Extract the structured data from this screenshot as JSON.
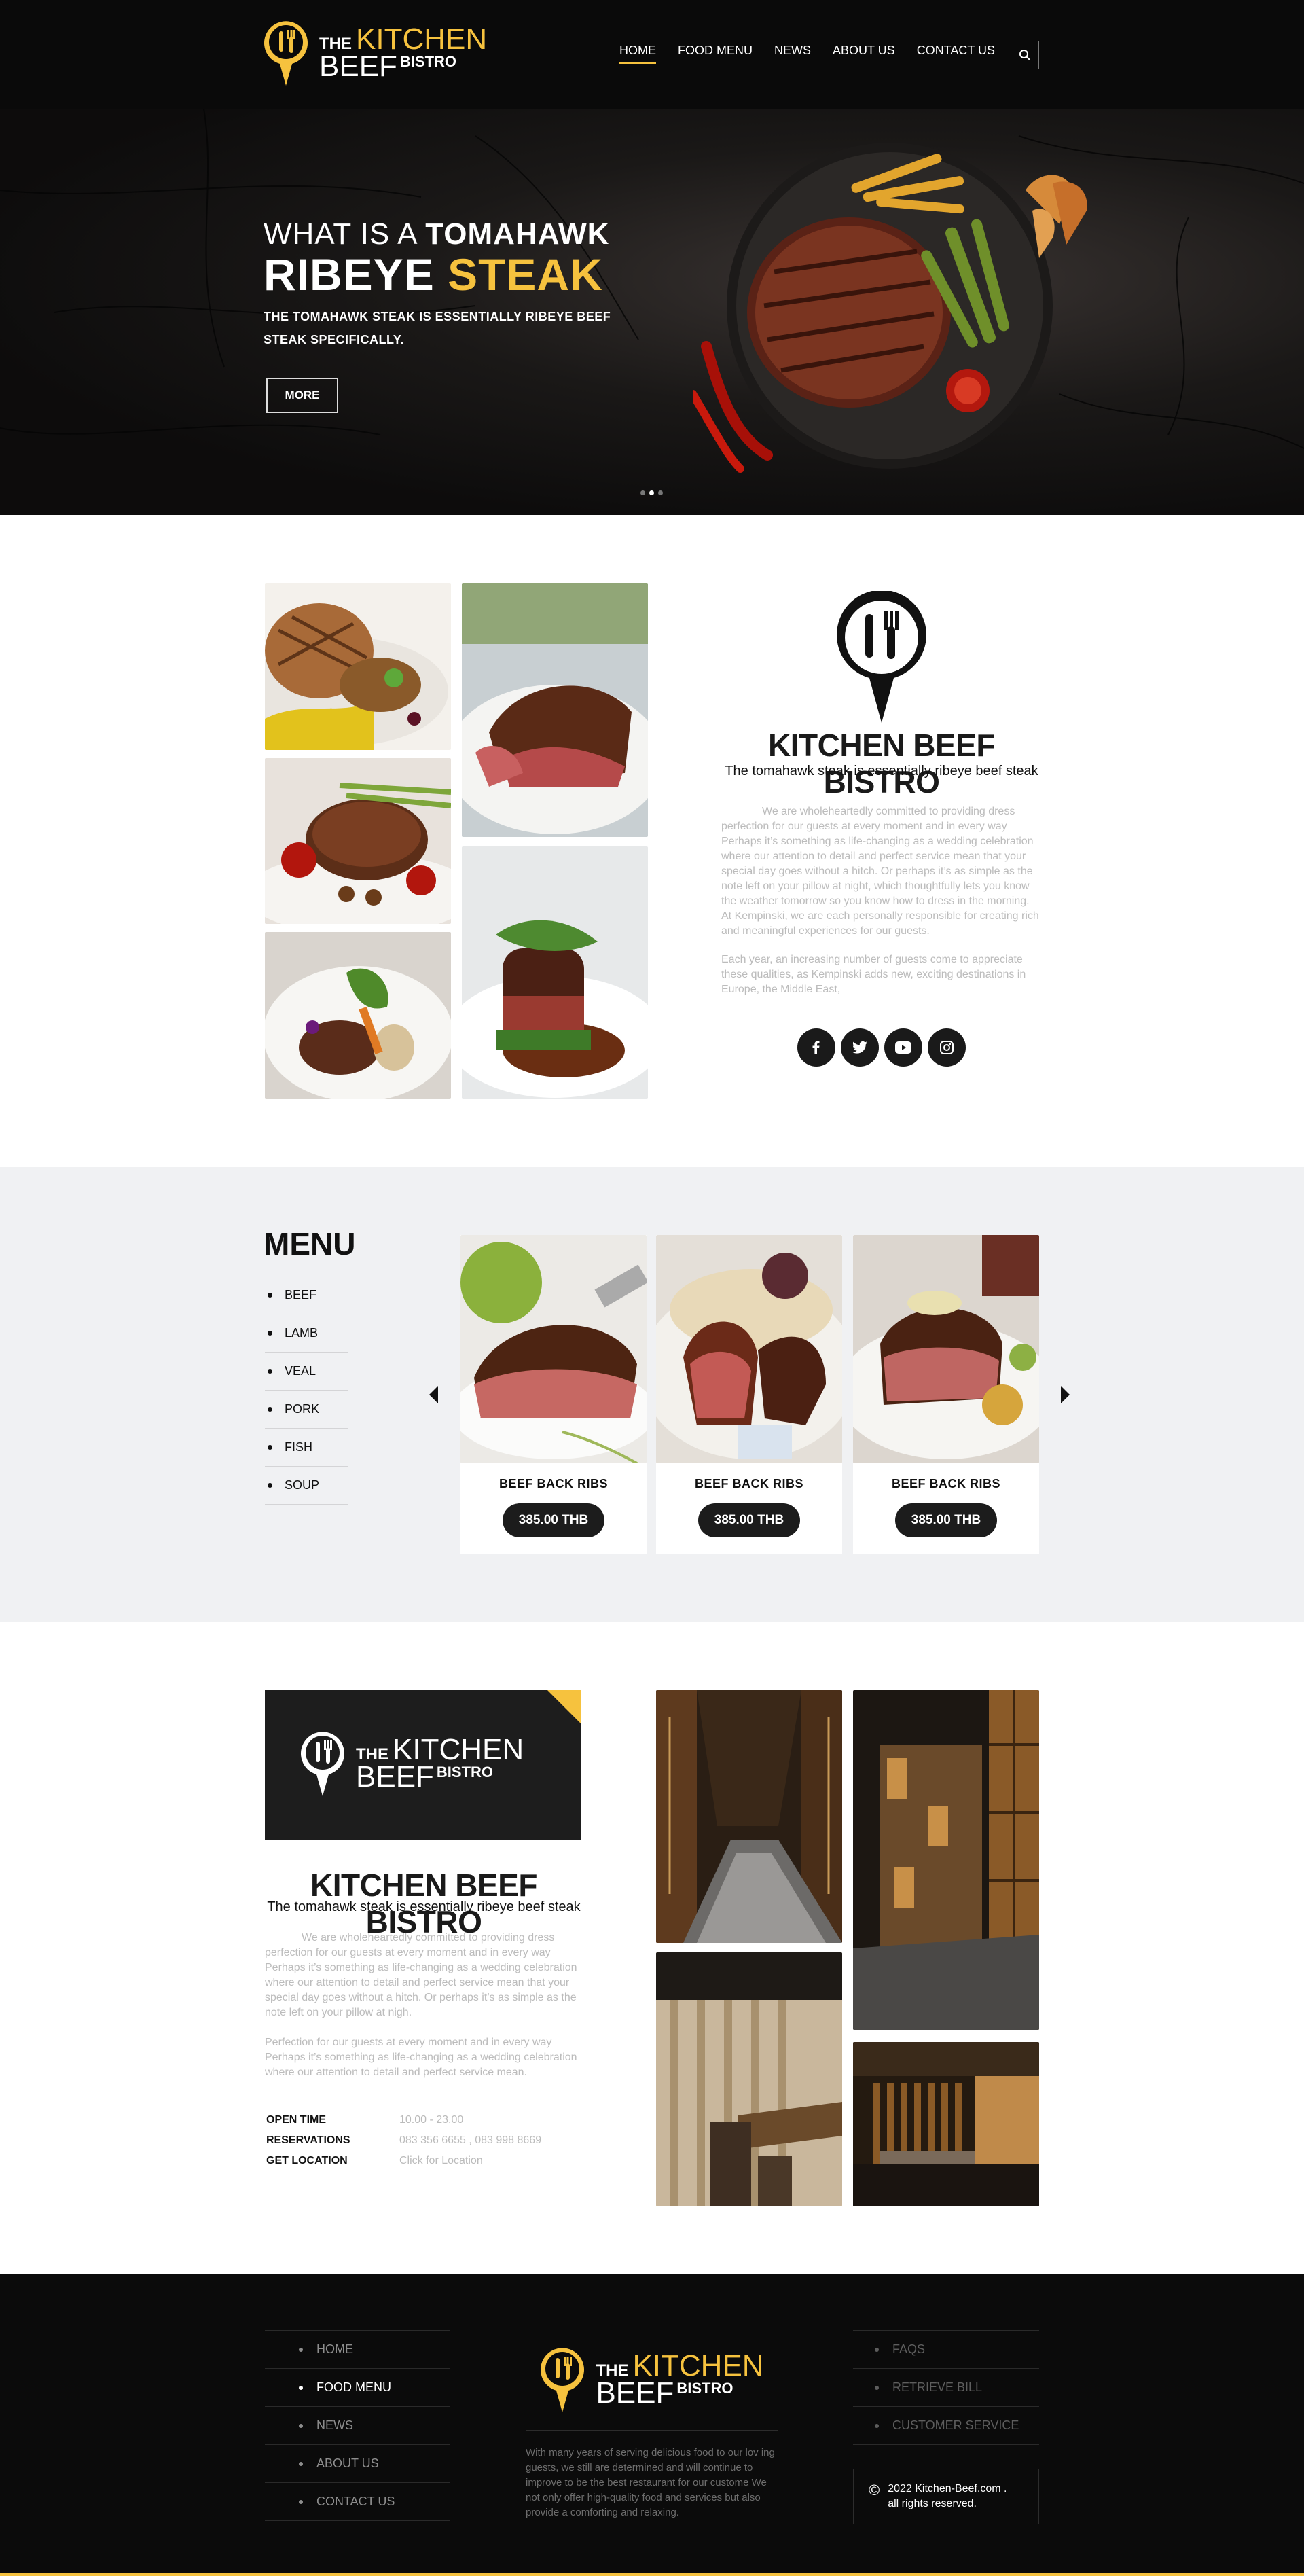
{
  "brand": {
    "the": "THE",
    "kitchen": "KITCHEN",
    "beef": "BEEF",
    "bistro": "BISTRO",
    "accent": "#f6c23e"
  },
  "nav": {
    "items": [
      "HOME",
      "FOOD MENU",
      "NEWS",
      "ABOUT US",
      "CONTACT US"
    ],
    "active": "HOME",
    "search_icon": "search-icon"
  },
  "hero": {
    "line1_prefix": "WHAT IS A ",
    "line1_bold": "TOMAHAWK",
    "line2_white": "RIBEYE ",
    "line2_yellow": "STEAK",
    "description": "THE TOMAHAWK STEAK IS ESSENTIALLY RIBEYE BEEF STEAK SPECIFICALLY.",
    "button": "MORE",
    "slides": 3,
    "active_slide": 2
  },
  "about": {
    "title": "KITCHEN BEEF BISTRO",
    "subtitle": "The tomahawk steak is essentially ribeye beef steak",
    "para1": "We are wholeheartedly committed to providing dress perfection for our guests at every moment and in every way Perhaps it’s something as life-changing as a wedding celebration where our attention to detail and perfect service mean that your special day goes without a hitch. Or perhaps it’s as simple as the note left on your pillow at night, which thoughtfully lets you know the weather tomorrow so you know how to dress in the morning. At Kempinski, we are each personally responsible for creating rich and meaningful experiences for our guests.",
    "para2": "Each year, an increasing number of guests come to appreciate these qualities, as Kempinski adds new, exciting destinations in Europe, the Middle East,",
    "social": [
      "facebook-icon",
      "twitter-icon",
      "youtube-icon",
      "instagram-icon"
    ]
  },
  "menu": {
    "title": "MENU",
    "categories": [
      "BEEF",
      "LAMB",
      "VEAL",
      "PORK",
      "FISH",
      "SOUP"
    ],
    "items": [
      {
        "name": "BEEF BACK RIBS",
        "price": "385.00  THB"
      },
      {
        "name": "BEEF BACK RIBS",
        "price": "385.00  THB"
      },
      {
        "name": "BEEF BACK RIBS",
        "price": "385.00  THB"
      }
    ]
  },
  "info": {
    "title": "KITCHEN BEEF BISTRO",
    "subtitle": "The tomahawk steak is essentially ribeye beef steak",
    "para1": "We are wholeheartedly committed to providing dress perfection for our guests at every moment and in every way Perhaps it’s something as life-changing as a wedding celebration where our attention to detail and perfect service mean that your special day goes without a hitch. Or perhaps it’s as simple as the note left on your pillow at nigh.",
    "para2": "Perfection for our guests at every moment and in every way Perhaps it’s something as life-changing as a wedding celebration where our attention to detail and perfect service mean.",
    "rows": [
      {
        "key": "OPEN TIME",
        "value": "10.00 - 23.00"
      },
      {
        "key": "RESERVATIONS",
        "value": "083 356 6655 , 083 998 8669"
      },
      {
        "key": "GET LOCATION",
        "value": "Click for Location"
      }
    ]
  },
  "footer": {
    "links": [
      "HOME",
      "FOOD MENU",
      "NEWS",
      "ABOUT US",
      "CONTACT US"
    ],
    "active": "FOOD MENU",
    "about": "With many years of serving delicious food to our lov ing guests, we still are determined and will continue to improve to be the best restaurant for our custome We not only offer high-quality food and services but also provide a comforting and relaxing.",
    "help": [
      "FAQS",
      "RETRIEVE BILL",
      "CUSTOMER SERVICE"
    ],
    "copyright_line1": "2022 Kitchen-Beef.com .",
    "copyright_line2": "all rights reserved.",
    "copyright_symbol": "©"
  }
}
